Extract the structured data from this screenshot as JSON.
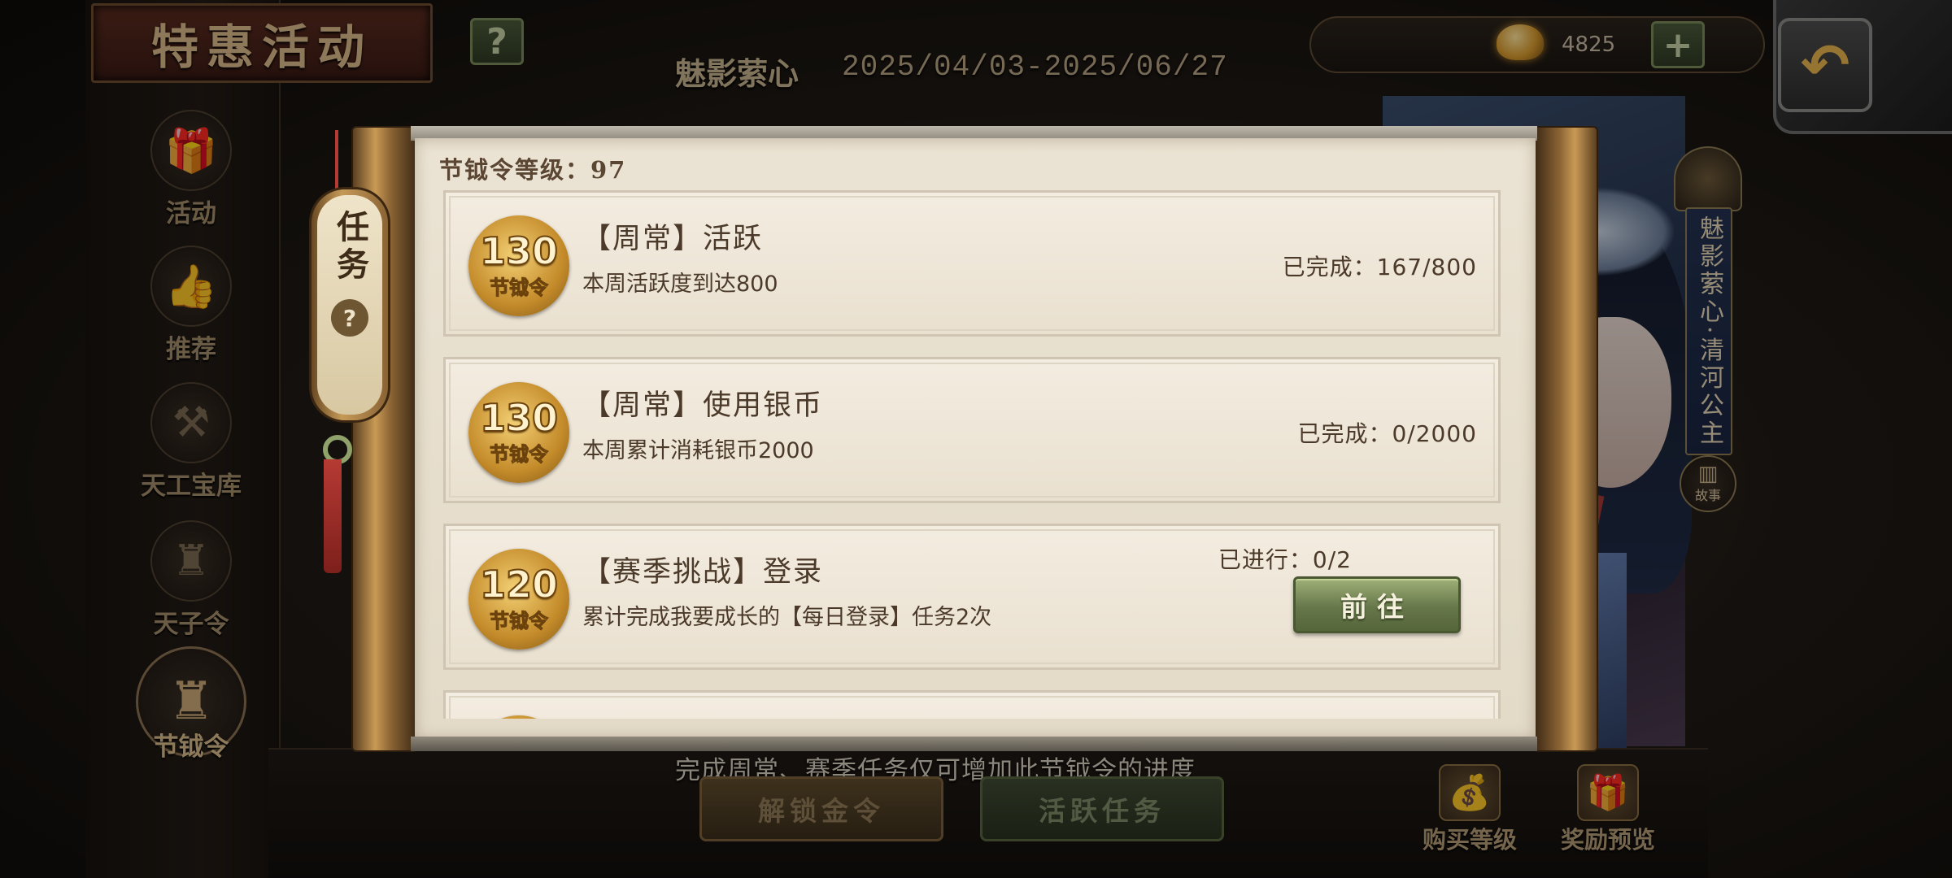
{
  "header": {
    "title": "特惠活动",
    "help_icon": "?",
    "event_name": "魅影萦心",
    "event_dates": "2025/04/03-2025/06/27",
    "currency_amount": "4825",
    "add_icon": "+",
    "back_icon": "↶"
  },
  "sidebar": {
    "items": [
      {
        "label": "活动",
        "icon": "gift-icon"
      },
      {
        "label": "推荐",
        "icon": "thumbs-up-icon"
      },
      {
        "label": "天工宝库",
        "icon": "treasury-icon"
      },
      {
        "label": "天子令",
        "icon": "emperor-token-icon"
      },
      {
        "label": "节钺令",
        "icon": "battle-pass-icon",
        "active": true
      }
    ]
  },
  "character": {
    "name_banner": "魅影萦心·清河公主",
    "story_label": "故事"
  },
  "modal": {
    "tag_label": "任务",
    "tag_help": "?",
    "level_text": "节钺令等级：97",
    "tasks": [
      {
        "reward_amount": "130",
        "reward_name": "节钺令",
        "title": "【周常】活跃",
        "description": "本周活跃度到达800",
        "progress": "已完成：167/800"
      },
      {
        "reward_amount": "130",
        "reward_name": "节钺令",
        "title": "【周常】使用银币",
        "description": "本周累计消耗银币2000",
        "progress": "已完成：0/2000"
      },
      {
        "reward_amount": "120",
        "reward_name": "节钺令",
        "title": "【赛季挑战】登录",
        "description": "累计完成我要成长的【每日登录】任务2次",
        "progress": "已进行：0/2",
        "button_label": "前往"
      },
      {
        "reward_amount": "",
        "reward_name": "",
        "title": "",
        "description": "",
        "progress": ""
      }
    ]
  },
  "footer": {
    "note": "完成周常、赛季任务仅可增加此节钺令的进度",
    "unlock_button": "解锁金令",
    "active_tasks_button": "活跃任务",
    "buy_level_label": "购买等级",
    "reward_preview_label": "奖励预览"
  },
  "colors": {
    "accent_gold": "#c48b2a",
    "button_green": "#66774a",
    "paper": "#ebe3d3"
  }
}
